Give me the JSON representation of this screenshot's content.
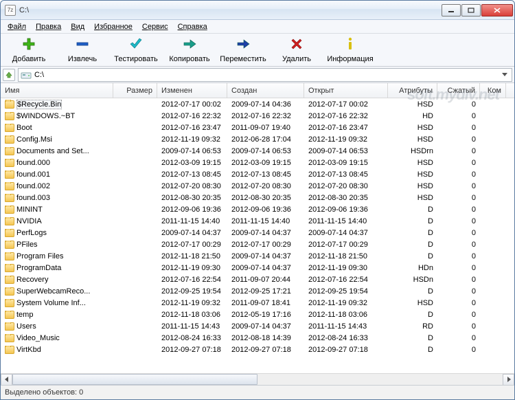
{
  "window": {
    "title": "C:\\"
  },
  "menu": {
    "items": [
      "Файл",
      "Правка",
      "Вид",
      "Избранное",
      "Сервис",
      "Справка"
    ]
  },
  "toolbar": {
    "items": [
      {
        "name": "add",
        "label": "Добавить",
        "color": "#3fb618",
        "shape": "plus"
      },
      {
        "name": "extract",
        "label": "Извлечь",
        "color": "#1f5fc7",
        "shape": "minus"
      },
      {
        "name": "test",
        "label": "Тестировать",
        "color": "#1fb8c7",
        "shape": "check"
      },
      {
        "name": "copy",
        "label": "Копировать",
        "color": "#1a9e8a",
        "shape": "arrow-right"
      },
      {
        "name": "move",
        "label": "Переместить",
        "color": "#1f3fa7",
        "shape": "arrow-right"
      },
      {
        "name": "delete",
        "label": "Удалить",
        "color": "#d02020",
        "shape": "x"
      },
      {
        "name": "info",
        "label": "Информация",
        "color": "#d8c010",
        "shape": "i"
      }
    ]
  },
  "address": {
    "path": "C:\\"
  },
  "columns": [
    "Имя",
    "Размер",
    "Изменен",
    "Создан",
    "Открыт",
    "Атрибуты",
    "Сжатый",
    "Ком"
  ],
  "rows": [
    {
      "name": "$Recycle.Bin",
      "size": "",
      "mod": "2012-07-17 00:02",
      "cre": "2009-07-14 04:36",
      "acc": "2012-07-17 00:02",
      "attr": "HSD",
      "packed": "0",
      "sel": true
    },
    {
      "name": "$WINDOWS.~BT",
      "size": "",
      "mod": "2012-07-16 22:32",
      "cre": "2012-07-16 22:32",
      "acc": "2012-07-16 22:32",
      "attr": "HD",
      "packed": "0"
    },
    {
      "name": "Boot",
      "size": "",
      "mod": "2012-07-16 23:47",
      "cre": "2011-09-07 19:40",
      "acc": "2012-07-16 23:47",
      "attr": "HSD",
      "packed": "0"
    },
    {
      "name": "Config.Msi",
      "size": "",
      "mod": "2012-11-19 09:32",
      "cre": "2012-06-28 17:04",
      "acc": "2012-11-19 09:32",
      "attr": "HSD",
      "packed": "0"
    },
    {
      "name": "Documents and Set...",
      "size": "",
      "mod": "2009-07-14 06:53",
      "cre": "2009-07-14 06:53",
      "acc": "2009-07-14 06:53",
      "attr": "HSDrn",
      "packed": "0"
    },
    {
      "name": "found.000",
      "size": "",
      "mod": "2012-03-09 19:15",
      "cre": "2012-03-09 19:15",
      "acc": "2012-03-09 19:15",
      "attr": "HSD",
      "packed": "0"
    },
    {
      "name": "found.001",
      "size": "",
      "mod": "2012-07-13 08:45",
      "cre": "2012-07-13 08:45",
      "acc": "2012-07-13 08:45",
      "attr": "HSD",
      "packed": "0"
    },
    {
      "name": "found.002",
      "size": "",
      "mod": "2012-07-20 08:30",
      "cre": "2012-07-20 08:30",
      "acc": "2012-07-20 08:30",
      "attr": "HSD",
      "packed": "0"
    },
    {
      "name": "found.003",
      "size": "",
      "mod": "2012-08-30 20:35",
      "cre": "2012-08-30 20:35",
      "acc": "2012-08-30 20:35",
      "attr": "HSD",
      "packed": "0"
    },
    {
      "name": "MININT",
      "size": "",
      "mod": "2012-09-06 19:36",
      "cre": "2012-09-06 19:36",
      "acc": "2012-09-06 19:36",
      "attr": "D",
      "packed": "0"
    },
    {
      "name": "NVIDIA",
      "size": "",
      "mod": "2011-11-15 14:40",
      "cre": "2011-11-15 14:40",
      "acc": "2011-11-15 14:40",
      "attr": "D",
      "packed": "0"
    },
    {
      "name": "PerfLogs",
      "size": "",
      "mod": "2009-07-14 04:37",
      "cre": "2009-07-14 04:37",
      "acc": "2009-07-14 04:37",
      "attr": "D",
      "packed": "0"
    },
    {
      "name": "PFiles",
      "size": "",
      "mod": "2012-07-17 00:29",
      "cre": "2012-07-17 00:29",
      "acc": "2012-07-17 00:29",
      "attr": "D",
      "packed": "0"
    },
    {
      "name": "Program Files",
      "size": "",
      "mod": "2012-11-18 21:50",
      "cre": "2009-07-14 04:37",
      "acc": "2012-11-18 21:50",
      "attr": "D",
      "packed": "0"
    },
    {
      "name": "ProgramData",
      "size": "",
      "mod": "2012-11-19 09:30",
      "cre": "2009-07-14 04:37",
      "acc": "2012-11-19 09:30",
      "attr": "HDn",
      "packed": "0"
    },
    {
      "name": "Recovery",
      "size": "",
      "mod": "2012-07-16 22:54",
      "cre": "2011-09-07 20:44",
      "acc": "2012-07-16 22:54",
      "attr": "HSDn",
      "packed": "0"
    },
    {
      "name": "SuperWebcamReco...",
      "size": "",
      "mod": "2012-09-25 19:54",
      "cre": "2012-09-25 17:21",
      "acc": "2012-09-25 19:54",
      "attr": "D",
      "packed": "0"
    },
    {
      "name": "System Volume Inf...",
      "size": "",
      "mod": "2012-11-19 09:32",
      "cre": "2011-09-07 18:41",
      "acc": "2012-11-19 09:32",
      "attr": "HSD",
      "packed": "0"
    },
    {
      "name": "temp",
      "size": "",
      "mod": "2012-11-18 03:06",
      "cre": "2012-05-19 17:16",
      "acc": "2012-11-18 03:06",
      "attr": "D",
      "packed": "0"
    },
    {
      "name": "Users",
      "size": "",
      "mod": "2011-11-15 14:43",
      "cre": "2009-07-14 04:37",
      "acc": "2011-11-15 14:43",
      "attr": "RD",
      "packed": "0"
    },
    {
      "name": "Video_Music",
      "size": "",
      "mod": "2012-08-24 16:33",
      "cre": "2012-08-18 14:39",
      "acc": "2012-08-24 16:33",
      "attr": "D",
      "packed": "0"
    },
    {
      "name": "VirtKbd",
      "size": "",
      "mod": "2012-09-27 07:18",
      "cre": "2012-09-27 07:18",
      "acc": "2012-09-27 07:18",
      "attr": "D",
      "packed": "0"
    }
  ],
  "status": {
    "text": "Выделено объектов: 0"
  },
  "watermark": "soft.mydiv.net"
}
